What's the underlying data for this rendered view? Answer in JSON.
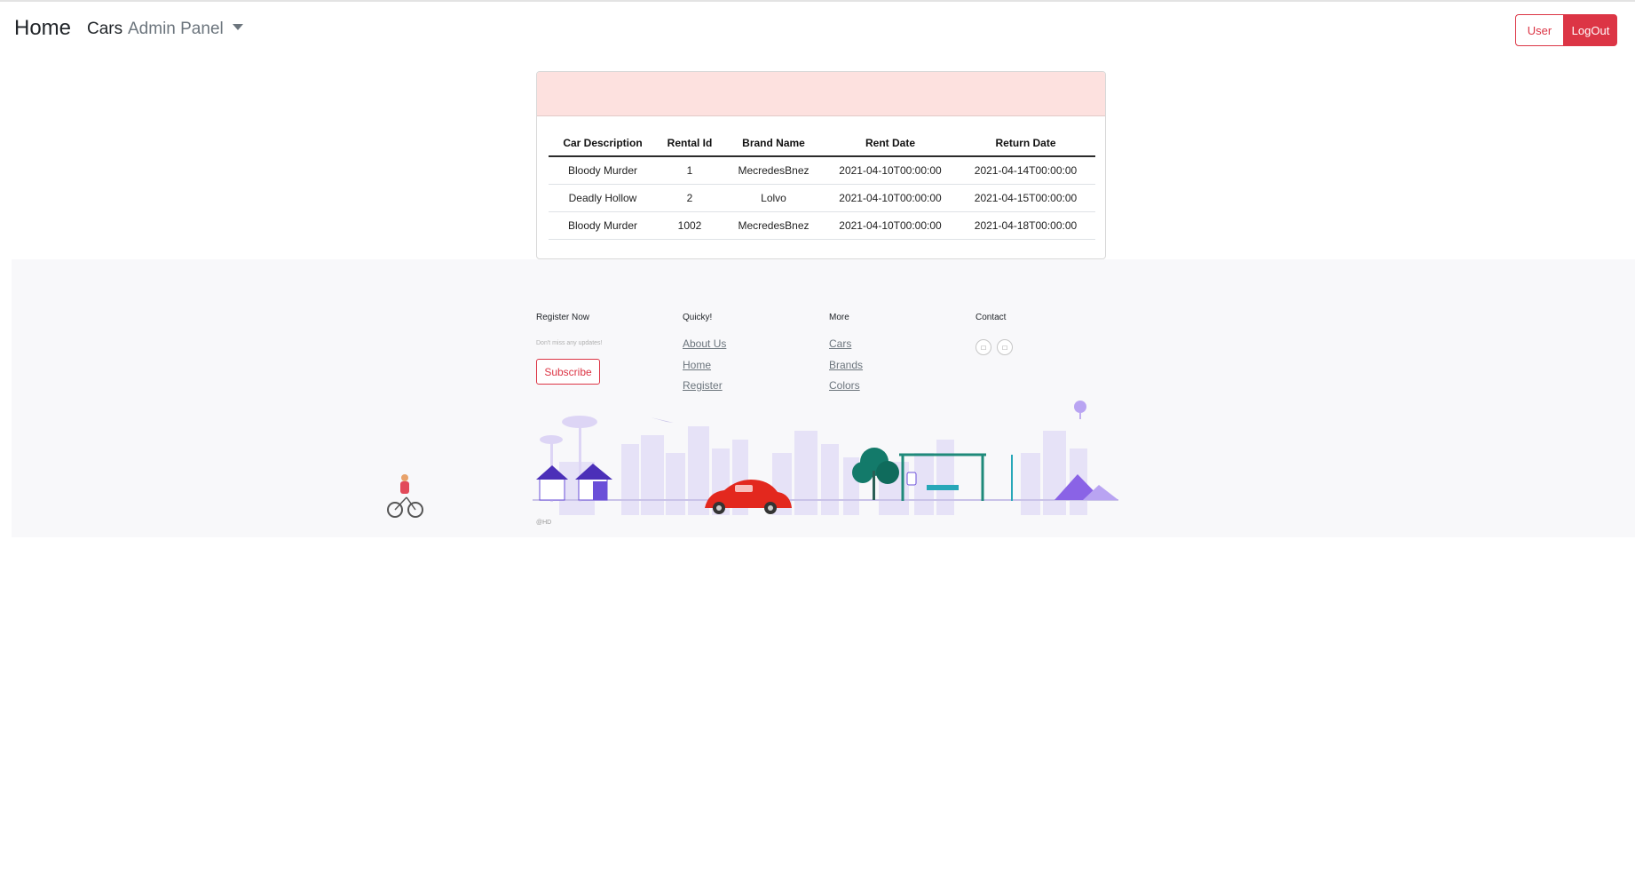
{
  "nav": {
    "brand": "Home",
    "cars": "Cars",
    "admin_panel": "Admin Panel",
    "user_button": "User",
    "logout_button": "LogOut"
  },
  "table": {
    "headers": [
      "Car Description",
      "Rental Id",
      "Brand Name",
      "Rent Date",
      "Return Date"
    ],
    "rows": [
      [
        "Bloody Murder",
        "1",
        "MecredesBnez",
        "2021-04-10T00:00:00",
        "2021-04-14T00:00:00"
      ],
      [
        "Deadly Hollow",
        "2",
        "Lolvo",
        "2021-04-10T00:00:00",
        "2021-04-15T00:00:00"
      ],
      [
        "Bloody Murder",
        "1002",
        "MecredesBnez",
        "2021-04-10T00:00:00",
        "2021-04-18T00:00:00"
      ]
    ]
  },
  "footer": {
    "register": {
      "heading": "Register Now",
      "text": "Don't miss any updates!",
      "button": "Subscribe"
    },
    "quick": {
      "heading": "Quicky!",
      "links": [
        "About Us",
        "Home",
        "Register"
      ]
    },
    "more": {
      "heading": "More",
      "links": [
        "Cars",
        "Brands",
        "Colors"
      ]
    },
    "contact": {
      "heading": "Contact",
      "icons": [
        "phone-icon",
        "mobile-icon"
      ]
    },
    "copyright": "@HD"
  },
  "colors": {
    "accent": "#dc3545",
    "card_header": "#fde1df",
    "footer_bg": "#f8f8fa"
  }
}
